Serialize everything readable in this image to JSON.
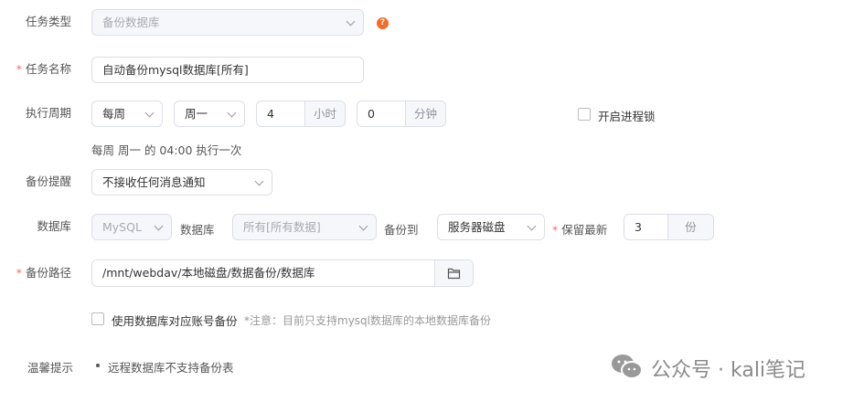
{
  "task_type": {
    "label": "任务类型",
    "value": "备份数据库"
  },
  "task_name": {
    "label": "任务名称",
    "value": "自动备份mysql数据库[所有]"
  },
  "schedule": {
    "label": "执行周期",
    "period": "每周",
    "weekday": "周一",
    "hour": "4",
    "hour_unit": "小时",
    "minute": "0",
    "minute_unit": "分钟",
    "lock_label": "开启进程锁",
    "summary": "每周 周一 的 04:00 执行一次"
  },
  "notify": {
    "label": "备份提醒",
    "value": "不接收任何消息通知"
  },
  "database": {
    "label": "数据库",
    "type": "MySQL",
    "db_label": "数据库",
    "db_value": "所有[所有数据]",
    "target_label": "备份到",
    "target_value": "服务器磁盘",
    "keep_label": "保留最新",
    "keep_value": "3",
    "keep_unit": "份"
  },
  "path": {
    "label": "备份路径",
    "value": "/mnt/webdav/本地磁盘/数据备份/数据库"
  },
  "account_backup": {
    "label": "使用数据库对应账号备份",
    "note": "*注意：目前只支持mysql数据库的本地数据库备份"
  },
  "tips": {
    "label": "温馨提示",
    "items": [
      "远程数据库不支持备份表"
    ]
  },
  "watermark": "公众号 · kali笔记",
  "colors": {
    "accent": "#f56c2a",
    "required": "#f56c6c"
  }
}
